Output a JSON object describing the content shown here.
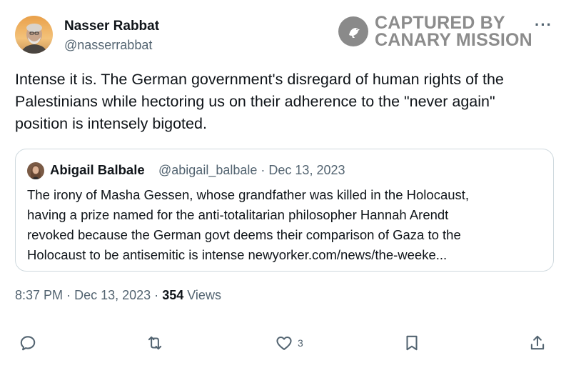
{
  "author": {
    "name": "Nasser Rabbat",
    "handle": "@nasserrabbat"
  },
  "watermark": {
    "line1": "CAPTURED BY",
    "line2": "CANARY MISSION"
  },
  "more_icon": "ellipsis-icon",
  "tweet": {
    "text": "Intense it is.  The German government's disregard of human rights of the\nPalestinians while hectoring us on their adherence to the \"never again\"\nposition is intensely bigoted."
  },
  "quote": {
    "name": "Abigail Balbale",
    "handle": "@abigail_balbale",
    "separator": "·",
    "date": "Dec 13, 2023",
    "text": "The irony of Masha Gessen, whose grandfather was killed in the Holocaust,\nhaving a prize named for the anti-totalitarian philosopher Hannah Arendt\nrevoked because the German govt deems their comparison of Gaza to the\nHolocaust to be antisemitic is intense newyorker.com/news/the-weeke..."
  },
  "meta": {
    "time": "8:37 PM",
    "separator": "·",
    "date": "Dec 13, 2023",
    "views_count": "354",
    "views_label": "Views"
  },
  "actions": {
    "reply_icon": "reply-icon",
    "retweet_icon": "retweet-icon",
    "like_icon": "heart-icon",
    "like_count": "3",
    "bookmark_icon": "bookmark-icon",
    "share_icon": "share-icon"
  },
  "colors": {
    "text": "#0f1419",
    "secondary": "#536471",
    "border": "#cfd9de",
    "watermark": "#8c8c8c"
  }
}
